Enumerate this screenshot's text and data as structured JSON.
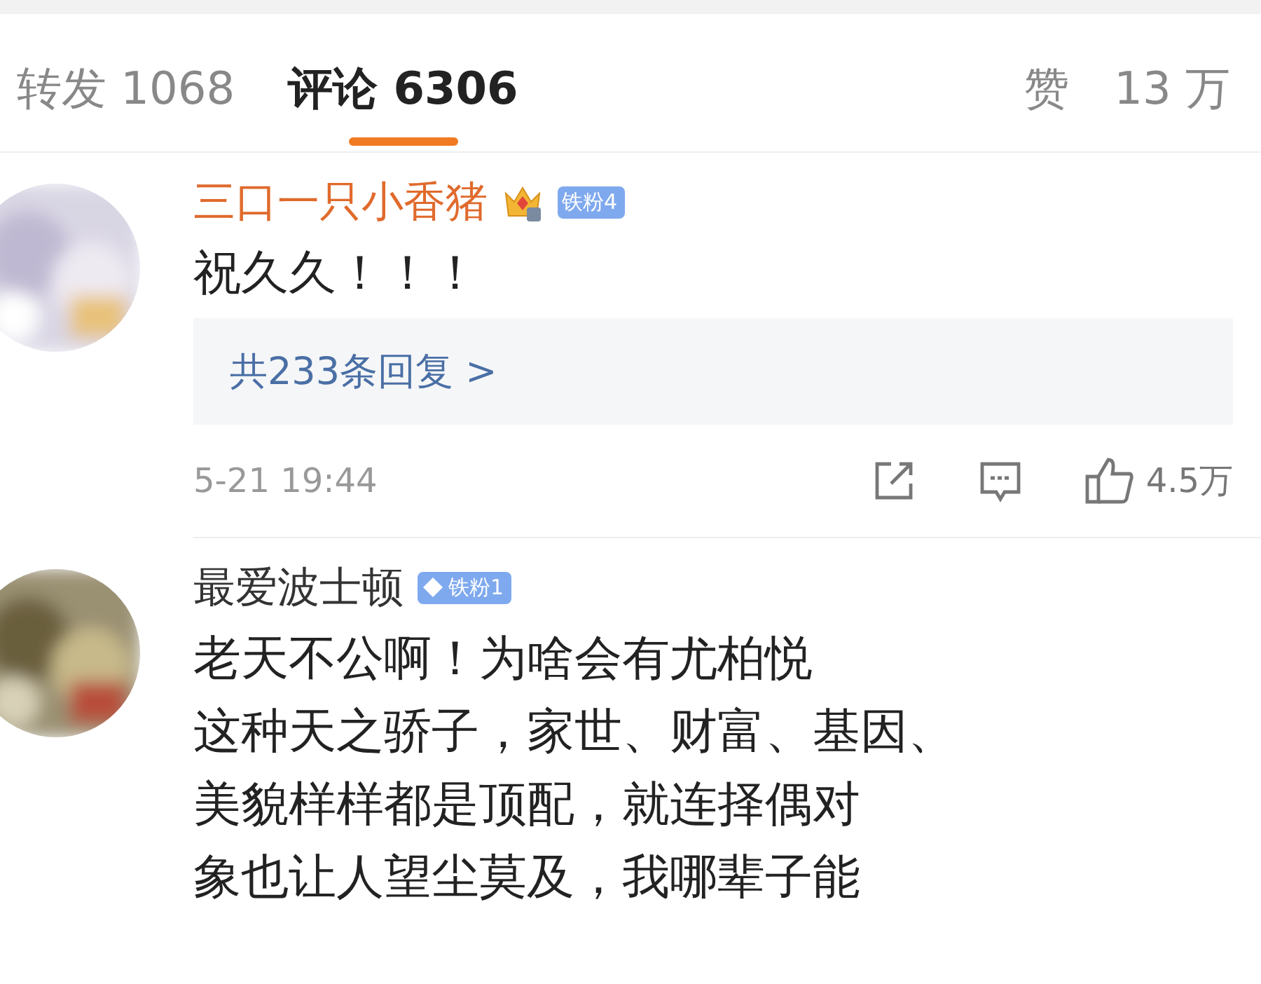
{
  "tabs": [
    {
      "label": "转发 1068",
      "selected": false
    },
    {
      "label": "评论 6306",
      "selected": true
    }
  ],
  "likes": {
    "label": "赞",
    "count": "13 万"
  },
  "comments": [
    {
      "user": "三口一只小香猪",
      "vip": true,
      "badge": {
        "kind": "crown",
        "label": "铁粉4"
      },
      "lines": [
        "祝久久！！！"
      ],
      "replies": "共233条回复 >",
      "time": "5-21 19:44",
      "like_count": "4.5万"
    },
    {
      "user": "最爱波士顿",
      "vip": false,
      "badge": {
        "kind": "diamond",
        "label": "铁粉1"
      },
      "lines": [
        "老天不公啊！为啥会有尤柏悦",
        "这种天之骄子，家世、财富、基因、",
        "美貌样样都是顶配，就连择偶对",
        "象也让人望尘莫及，我哪辈子能"
      ]
    }
  ]
}
